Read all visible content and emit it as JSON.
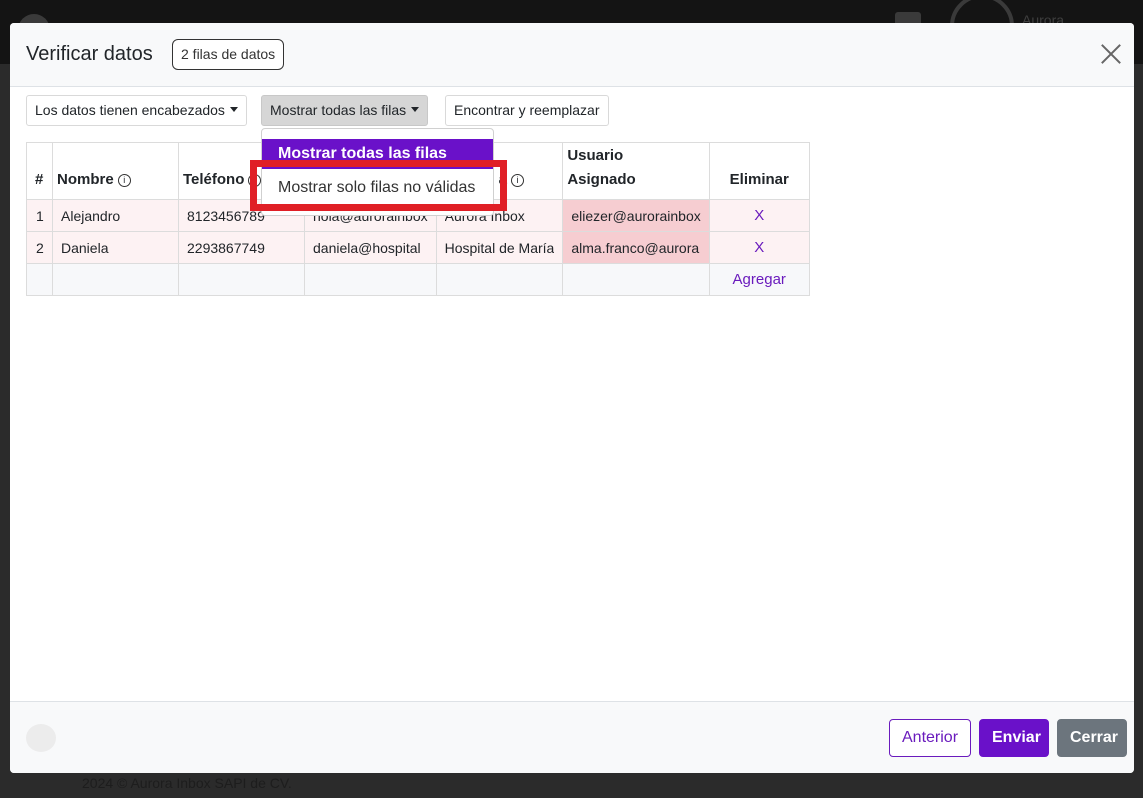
{
  "background": {
    "user_name": "Aurora",
    "footer_text": "2024 © Aurora Inbox SAPI de CV."
  },
  "modal": {
    "title": "Verificar datos",
    "row_count_badge": "2 filas de datos"
  },
  "toolbar": {
    "headers_label": "Los datos tienen encabezados",
    "filter_label": "Mostrar todas las filas",
    "replace_label": "Encontrar y reemplazar"
  },
  "filter_menu": {
    "options": [
      "Mostrar todas las filas",
      "Mostrar solo filas no válidas"
    ],
    "selected": "Mostrar todas las filas"
  },
  "table": {
    "columns": {
      "index": "#",
      "name": "Nombre",
      "phone": "Teléfono",
      "email": "",
      "company": "a",
      "assigned_user_line1": "Usuario",
      "assigned_user_line2": "Asignado",
      "delete": "Eliminar"
    },
    "rows": [
      {
        "index": "1",
        "name": "Alejandro",
        "phone": "8123456789",
        "email": "hola@aurorainbox",
        "company": "Aurora Inbox",
        "assigned_user": "eliezer@aurorainbox",
        "delete": "X"
      },
      {
        "index": "2",
        "name": "Daniela",
        "phone": "2293867749",
        "email": "daniela@hospital",
        "company": "Hospital de María",
        "assigned_user": "alma.franco@aurora",
        "delete": "X"
      }
    ],
    "add_label": "Agregar"
  },
  "footer": {
    "prev_label": "Anterior",
    "send_label": "Enviar",
    "close_label": "Cerrar"
  },
  "colors": {
    "accent": "#6a11c9",
    "highlight": "#e01f26",
    "invalid_cell": "#f6cdd1",
    "secondary": "#6c757d"
  }
}
